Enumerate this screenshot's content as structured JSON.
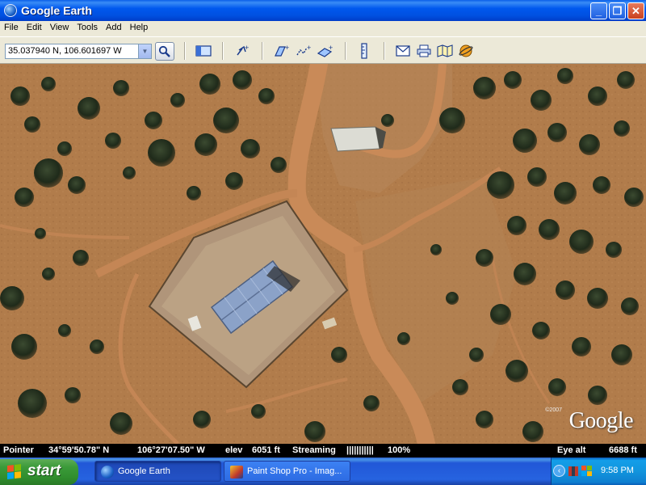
{
  "window": {
    "title": "Google Earth",
    "controls": {
      "minimize": "_",
      "maximize": "❐",
      "close": "✕"
    }
  },
  "menu": [
    "File",
    "Edit",
    "View",
    "Tools",
    "Add",
    "Help"
  ],
  "toolbar": {
    "search_value": "35.037940 N, 106.601697 W",
    "icons": [
      "search-icon",
      "sidebar-toggle-icon",
      "placemark-icon",
      "polygon-icon",
      "path-icon",
      "image-overlay-icon",
      "ruler-icon",
      "email-icon",
      "print-icon",
      "google-maps-icon",
      "sky-icon"
    ]
  },
  "map": {
    "attribution": "©2007",
    "logo": "Google"
  },
  "status": {
    "pointer_label": "Pointer",
    "latitude": "34°59'50.78\" N",
    "longitude": "106°27'07.50\" W",
    "elev_label": "elev",
    "elevation": "6051 ft",
    "streaming_label": "Streaming",
    "streaming_bar": "|||||||||||",
    "streaming_percent": "100%",
    "eye_alt_label": "Eye alt",
    "eye_alt": "6688 ft"
  },
  "taskbar": {
    "start_label": "start",
    "tasks": [
      {
        "label": "Google Earth",
        "active": true
      },
      {
        "label": "Paint Shop Pro - Imag...",
        "active": false
      }
    ],
    "clock": "9:58 PM"
  },
  "colors": {
    "titlebar": "#0058ee",
    "taskbar": "#2663e0",
    "start_button": "#3c9b3a",
    "ground": "#b07a48",
    "road": "#c98a58"
  }
}
